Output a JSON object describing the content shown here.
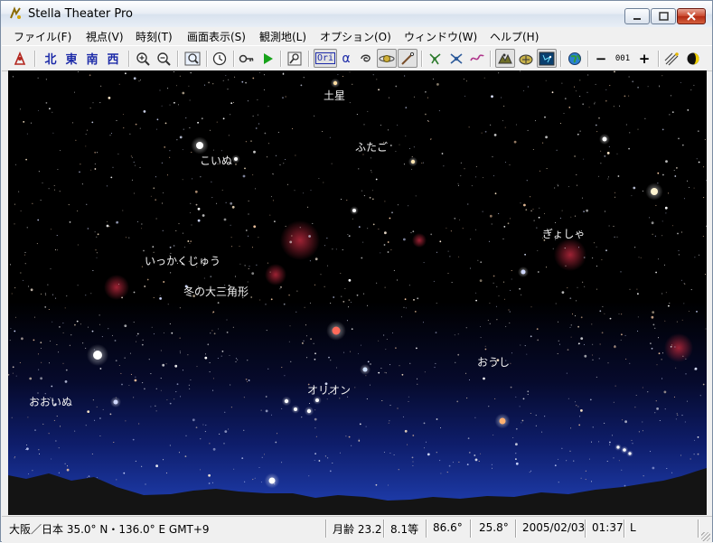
{
  "window": {
    "title": "Stella Theater Pro"
  },
  "menu": [
    "ファイル(F)",
    "視点(V)",
    "時刻(T)",
    "画面表示(S)",
    "観測地(L)",
    "オプション(O)",
    "ウィンドウ(W)",
    "ヘルプ(H)"
  ],
  "toolbar": {
    "directions": [
      "北",
      "東",
      "南",
      "西"
    ],
    "ori_label": "Ori",
    "alpha_label": "α",
    "mag_label": "001",
    "minus_label": "−",
    "plus_label": "+"
  },
  "sky": {
    "labels": {
      "saturn": "土星",
      "canis_minor": "こいぬ",
      "gemini": "ふたご",
      "auriga": "ぎょしゃ",
      "monoceros": "いっかくじゅう",
      "winter_triangle": "冬の大三角形",
      "taurus": "おうし",
      "orion": "オリオン",
      "canis_major": "おおいぬ"
    }
  },
  "status": {
    "location": "大阪／日本  35.0° N・136.0° E  GMT+9",
    "moon_age": "月齢 23.2",
    "limit_mag": "8.1等",
    "fov": "86.6°",
    "alt": "25.8°",
    "date": "2005/02/03",
    "time": "01:37",
    "mode": "L"
  },
  "colors": {
    "sky_top": "#000000",
    "horizon_glow": "#1d3aa7",
    "ground": "#141414"
  }
}
